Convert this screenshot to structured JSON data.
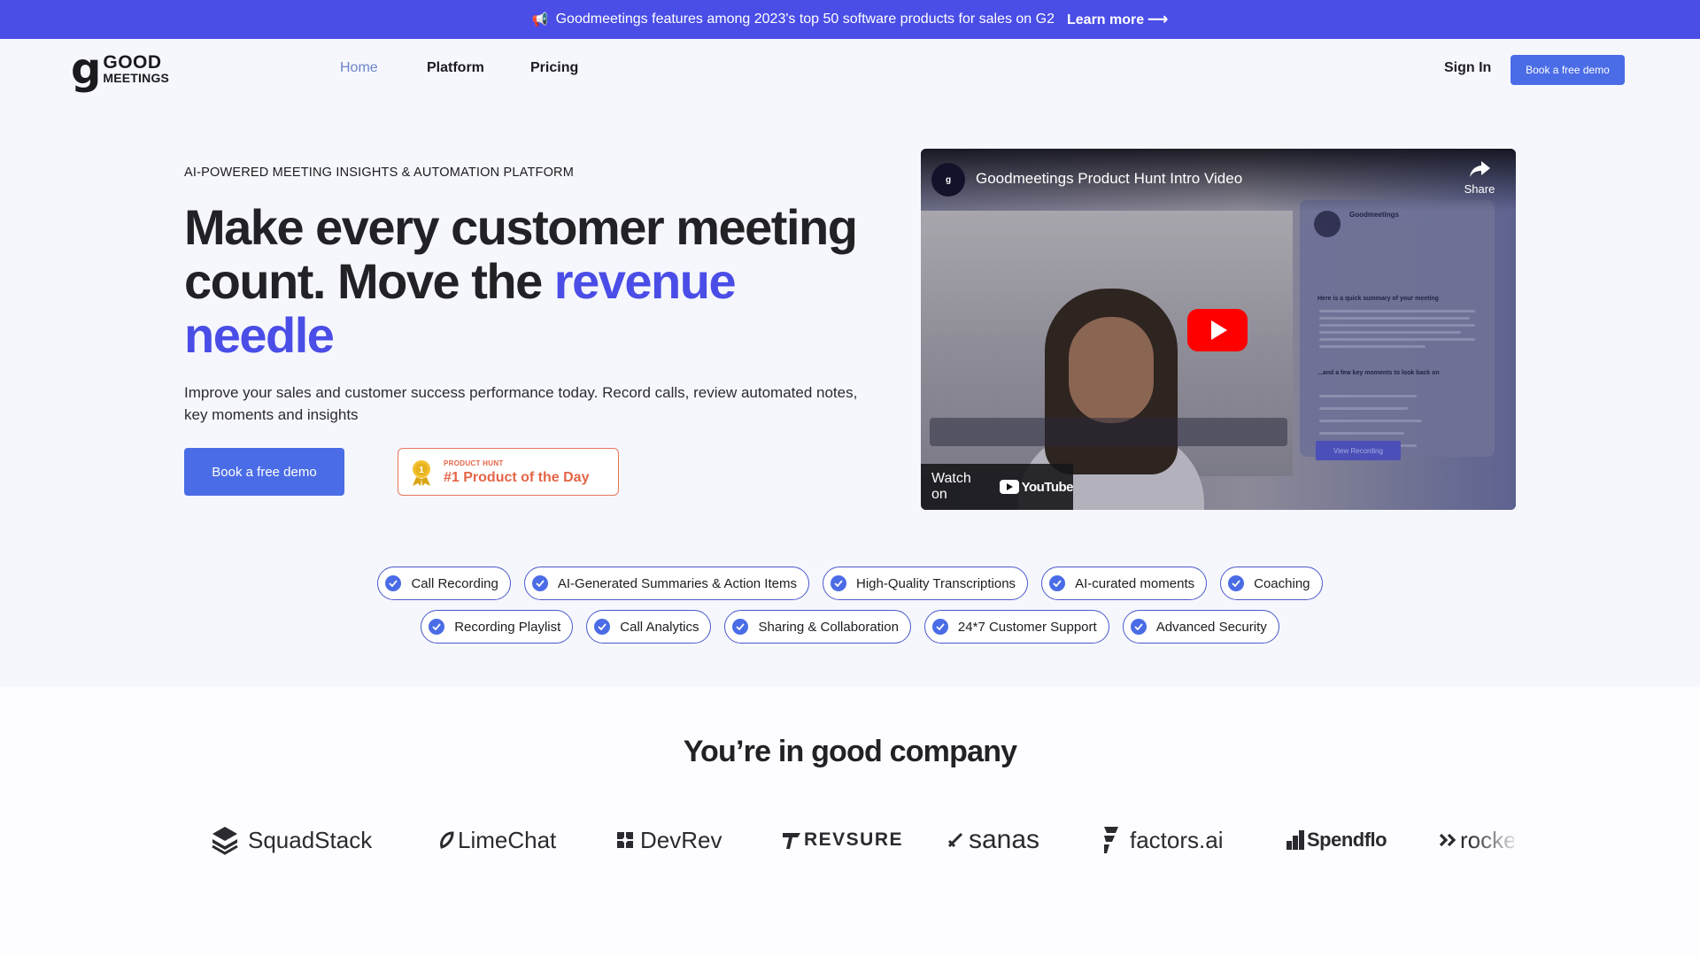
{
  "banner": {
    "megaphone_icon": "megaphone-icon",
    "text": "Goodmeetings features among 2023's top 50 software products for sales on G2",
    "link": "Learn more",
    "arrow": "⟶"
  },
  "brand": {
    "logo_top": "GOOD",
    "logo_bottom": "MEETINGS"
  },
  "nav": {
    "links": [
      "Home",
      "Platform",
      "Pricing"
    ],
    "sign_in": "Sign In",
    "demo": "Book a free demo"
  },
  "hero": {
    "eyebrow": "AI-POWERED MEETING INSIGHTS & AUTOMATION PLATFORM",
    "headline_1": "Make every customer meeting count. Move the",
    "headline_accent": "revenue needle",
    "subtext": "Improve your sales and customer success performance today. Record calls, review automated notes, key moments and insights",
    "cta": "Book a free demo",
    "badge_small": "PRODUCT HUNT",
    "badge_big": "#1 Product of the Day"
  },
  "video": {
    "title": "Goodmeetings Product Hunt Intro Video",
    "share": "Share",
    "watch_on": "Watch on",
    "youtube": "YouTube",
    "email_heading": "Here is a quick summary of your meeting",
    "email_moments": "...and a few key moments to look back on",
    "email_button": "View Recording",
    "sender": "Goodmeetings"
  },
  "features": {
    "row1": [
      "Call Recording",
      "AI-Generated Summaries & Action Items",
      "High-Quality Transcriptions",
      "AI-curated moments",
      "Coaching"
    ],
    "row2": [
      "Recording Playlist",
      "Call Analytics",
      "Sharing & Collaboration",
      "24*7 Customer Support",
      "Advanced Security"
    ]
  },
  "company": {
    "title": "You’re in good company",
    "logos": [
      "SquadStack",
      "LimeChat",
      "DevRev",
      "REVSURE",
      "sanas",
      "factors.ai",
      "Spendflo",
      "rocket"
    ]
  },
  "colors": {
    "brand": "#4a4de6",
    "button": "#4a6ce6",
    "badge": "#e36546"
  }
}
